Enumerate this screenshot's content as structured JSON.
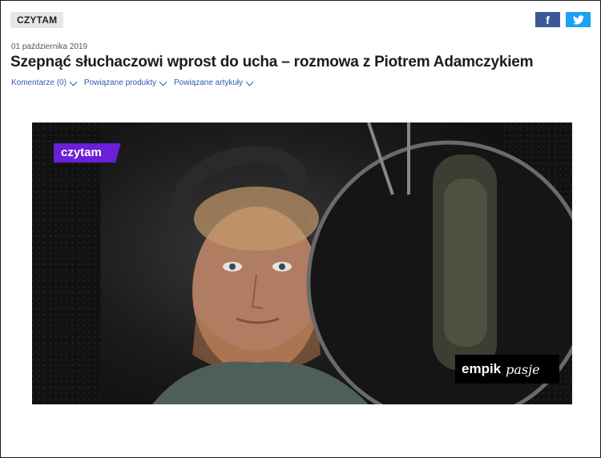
{
  "header": {
    "category": "CZYTAM",
    "social": {
      "facebook": "f",
      "twitter": "twitter-bird"
    }
  },
  "article": {
    "date": "01 października 2019",
    "title": "Szepnąć słuchaczowi wprost do ucha – rozmowa z Piotrem Adamczykiem",
    "links": [
      {
        "label": "Komentarze (0)"
      },
      {
        "label": "Powiązane produkty"
      },
      {
        "label": "Powiązane artykuły"
      }
    ]
  },
  "hero": {
    "badge": "czytam",
    "brand_word1": "empik",
    "brand_word2": "pasje",
    "accent": "#6b1fd8"
  }
}
